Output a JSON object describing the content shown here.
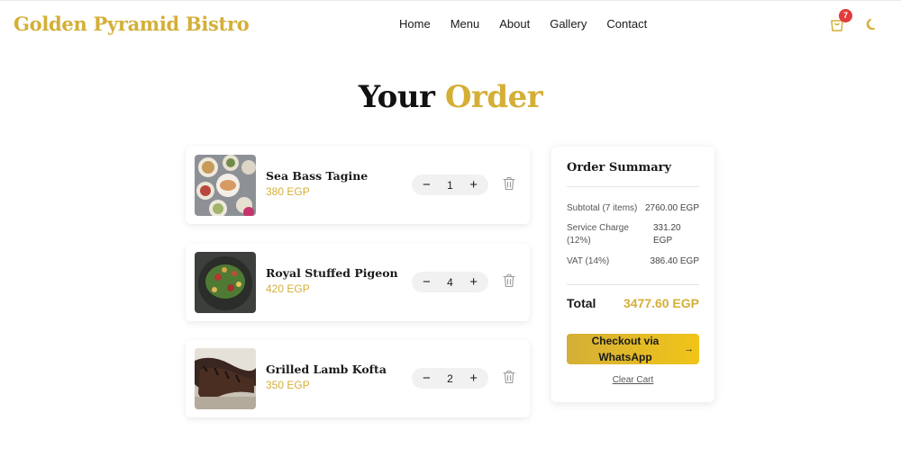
{
  "header": {
    "brand": "Golden Pyramid Bistro",
    "nav": [
      "Home",
      "Menu",
      "About",
      "Gallery",
      "Contact"
    ],
    "cart_count": "7",
    "cart_icon": "shopping-bag-icon",
    "theme_icon": "moon-icon"
  },
  "page_title": {
    "part1": "Your",
    "part2": "Order"
  },
  "items": [
    {
      "name": "Sea Bass Tagine",
      "price": "380 EGP",
      "qty": "1"
    },
    {
      "name": "Royal Stuffed Pigeon",
      "price": "420 EGP",
      "qty": "4"
    },
    {
      "name": "Grilled Lamb Kofta",
      "price": "350 EGP",
      "qty": "2"
    }
  ],
  "qty_controls": {
    "minus": "−",
    "plus": "+"
  },
  "summary": {
    "title": "Order Summary",
    "subtotal_label": "Subtotal (7 items)",
    "subtotal_value": "2760.00 EGP",
    "service_label_1": "Service Charge",
    "service_label_2": "(12%)",
    "service_value_1": "331.20",
    "service_value_2": "EGP",
    "vat_label": "VAT (14%)",
    "vat_value": "386.40 EGP",
    "total_label": "Total",
    "total_value": "3477.60 EGP",
    "checkout_line1": "Checkout via",
    "checkout_line2": "WhatsApp",
    "checkout_arrow": "→",
    "clear_cart": "Clear Cart"
  },
  "colors": {
    "gold": "#d4af37",
    "badge": "#e23b3b"
  }
}
